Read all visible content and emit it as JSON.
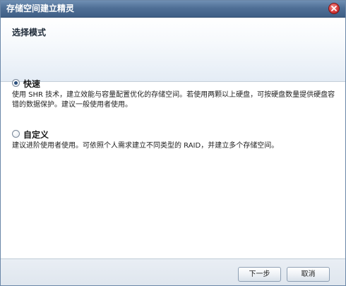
{
  "window": {
    "title": "存储空间建立精灵"
  },
  "header": {
    "title": "选择模式"
  },
  "options": [
    {
      "label": "快速",
      "selected": true,
      "description": "使用 SHR 技术，建立效能与容量配置优化的存储空间。若使用两颗以上硬盘，可按硬盘数量提供硬盘容错的数据保护。建议一般使用者使用。"
    },
    {
      "label": "自定义",
      "selected": false,
      "description": "建议进阶使用者使用。可依照个人需求建立不同类型的 RAID，并建立多个存储空间。"
    }
  ],
  "footer": {
    "next_label": "下一步",
    "cancel_label": "取消"
  },
  "icons": {
    "close": "close-icon"
  }
}
